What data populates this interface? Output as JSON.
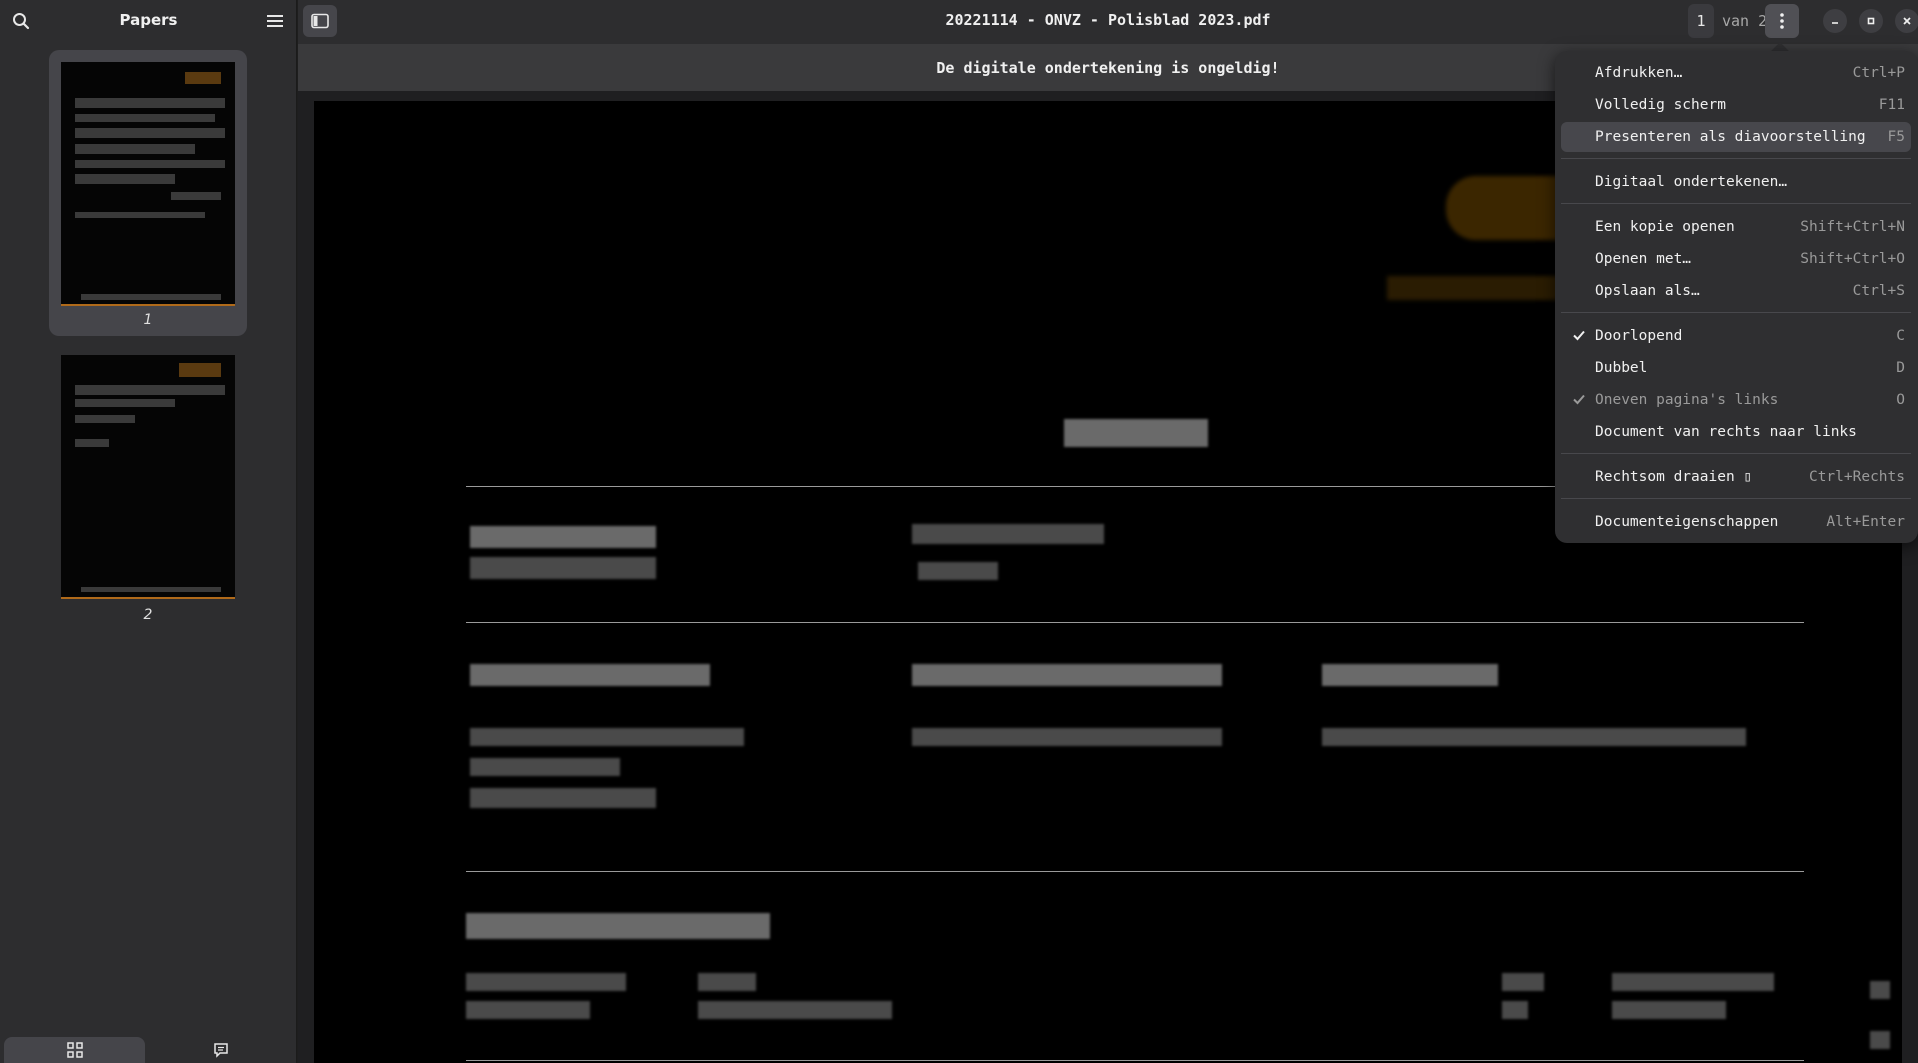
{
  "sidebar": {
    "title": "Papers",
    "thumbnails": [
      {
        "label": "1"
      },
      {
        "label": "2"
      }
    ]
  },
  "header": {
    "title": "20221114 - ONVZ - Polisblad 2023.pdf",
    "page_current": "1",
    "page_of": "van 2"
  },
  "banner": {
    "text": "De digitale ondertekening is ongeldig!"
  },
  "menu": {
    "items": [
      {
        "label": "Afdrukken…",
        "accel": "Ctrl+P"
      },
      {
        "label": "Volledig scherm",
        "accel": "F11"
      },
      {
        "label": "Presenteren als diavoorstelling",
        "accel": "F5"
      },
      {
        "label": "Digitaal ondertekenen…",
        "accel": ""
      },
      {
        "label": "Een kopie openen",
        "accel": "Shift+Ctrl+N"
      },
      {
        "label": "Openen met…",
        "accel": "Shift+Ctrl+O"
      },
      {
        "label": "Opslaan als…",
        "accel": "Ctrl+S"
      },
      {
        "label": "Doorlopend",
        "accel": "C",
        "checked": true
      },
      {
        "label": "Dubbel",
        "accel": "D"
      },
      {
        "label": "Oneven pagina's links",
        "accel": "O",
        "checked": true,
        "disabled": true
      },
      {
        "label": "Document van rechts naar links",
        "accel": ""
      },
      {
        "label": "Rechtsom draaien ▯",
        "accel": "Ctrl+Rechts"
      },
      {
        "label": "Documenteigenschappen",
        "accel": "Alt+Enter"
      }
    ]
  },
  "colors": {
    "accent_highlight": "#47474c",
    "thumb_underline": "#b06a1a"
  },
  "icons": [
    "search-icon",
    "hamburger-icon",
    "sidebar-toggle-icon",
    "kebab-menu-icon",
    "minimize-icon",
    "maximize-icon",
    "close-icon",
    "check-icon",
    "grid-icon",
    "comment-icon"
  ]
}
